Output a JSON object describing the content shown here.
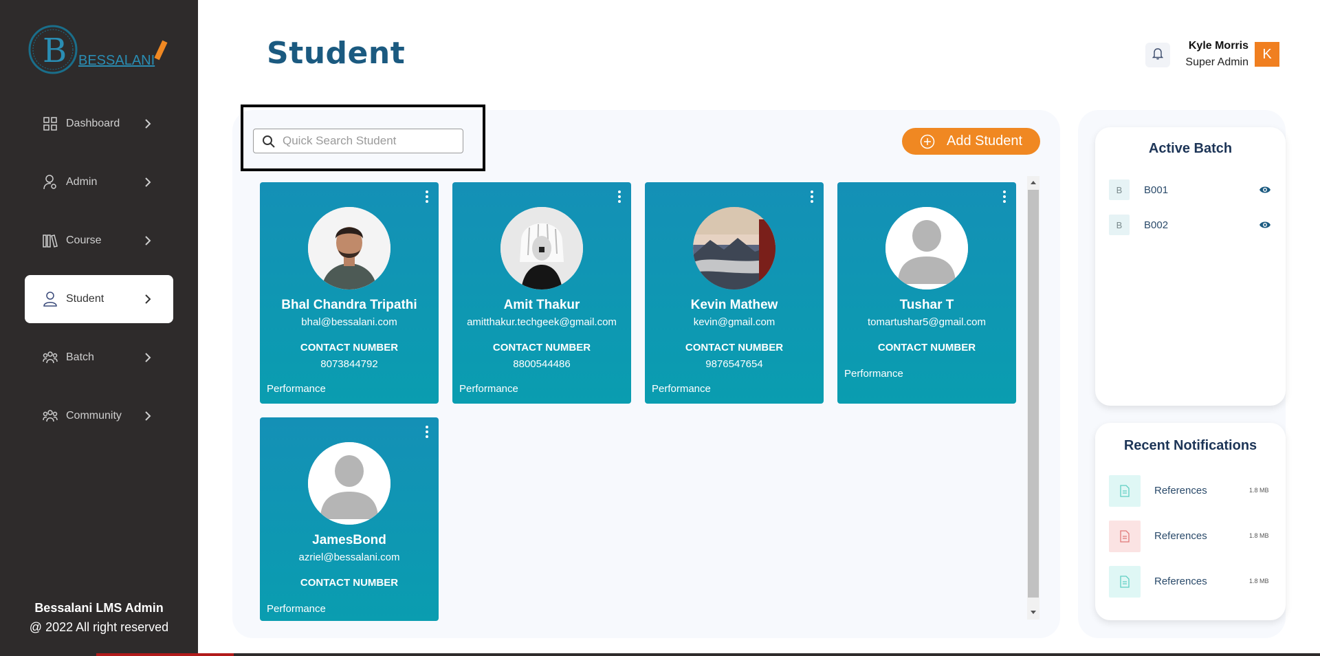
{
  "brand": {
    "logo_text": "BESSALANI",
    "logo_letter": "B"
  },
  "sidebar": {
    "items": [
      {
        "label": "Dashboard",
        "icon": "grid-icon",
        "active": false
      },
      {
        "label": "Admin",
        "icon": "admin-user-icon",
        "active": false
      },
      {
        "label": "Course",
        "icon": "books-icon",
        "active": false
      },
      {
        "label": "Student",
        "icon": "user-icon",
        "active": true
      },
      {
        "label": "Batch",
        "icon": "group-icon",
        "active": false
      },
      {
        "label": "Community",
        "icon": "community-icon",
        "active": false
      }
    ],
    "footer_title": "Bessalani LMS Admin",
    "footer_copy": "@ 2022 All right reserved"
  },
  "header": {
    "title": "Student",
    "user_name": "Kyle Morris",
    "user_role": "Super Admin",
    "avatar_letter": "K"
  },
  "search": {
    "placeholder": "Quick Search Student",
    "value": ""
  },
  "add_button": {
    "label": "Add Student"
  },
  "students": [
    {
      "name": "Bhal Chandra Tripathi",
      "email": "bhal@bessalani.com",
      "contact_label": "CONTACT NUMBER",
      "phone": "8073844792",
      "performance_label": "Performance",
      "photo": "person-photo"
    },
    {
      "name": "Amit Thakur",
      "email": "amitthakur.techgeek@gmail.com",
      "contact_label": "CONTACT NUMBER",
      "phone": "8800544486",
      "performance_label": "Performance",
      "photo": "anime-photo"
    },
    {
      "name": "Kevin Mathew",
      "email": "kevin@gmail.com",
      "contact_label": "CONTACT NUMBER",
      "phone": "9876547654",
      "performance_label": "Performance",
      "photo": "mountain-photo"
    },
    {
      "name": "Tushar T",
      "email": "tomartushar5@gmail.com",
      "contact_label": "CONTACT NUMBER",
      "phone": "",
      "performance_label": "Performance",
      "photo": "default-avatar"
    },
    {
      "name": "JamesBond",
      "email": "azriel@bessalani.com",
      "contact_label": "CONTACT NUMBER",
      "phone": "",
      "performance_label": "Performance",
      "photo": "default-avatar"
    }
  ],
  "active_batch": {
    "title": "Active Batch",
    "items": [
      {
        "letter": "B",
        "name": "B001"
      },
      {
        "letter": "B",
        "name": "B002"
      }
    ]
  },
  "notifications": {
    "title": "Recent Notifications",
    "items": [
      {
        "text": "References",
        "size": "1.8 MB",
        "color": "#dff7f5"
      },
      {
        "text": "References",
        "size": "1.8 MB",
        "color": "#fbe3e3"
      },
      {
        "text": "References",
        "size": "1.8 MB",
        "color": "#dff7f5"
      }
    ]
  },
  "colors": {
    "accent": "#f08822",
    "title": "#1b5a80",
    "sidebar": "#2e2b2b",
    "card": "#1490b6"
  }
}
